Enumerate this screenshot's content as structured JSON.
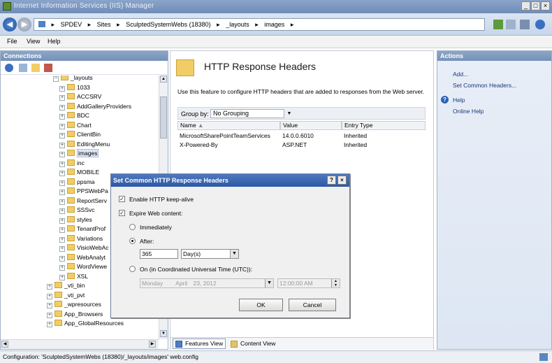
{
  "window": {
    "title": "Internet Information Services (IIS) Manager",
    "min": "_",
    "max": "□",
    "close": "×"
  },
  "address": {
    "crumbs": [
      "SPDEV",
      "Sites",
      "SculptedSystemWebs (18380)",
      "_layouts",
      "images"
    ]
  },
  "menu": {
    "file": "File",
    "view": "View",
    "help": "Help"
  },
  "connections": {
    "title": "Connections",
    "tree": [
      {
        "label": "_layouts",
        "pm": "−"
      },
      {
        "label": "1033",
        "pm": "+"
      },
      {
        "label": "ACCSRV",
        "pm": "+"
      },
      {
        "label": "AddGalleryProviders",
        "pm": "+"
      },
      {
        "label": "BDC",
        "pm": "+"
      },
      {
        "label": "Chart",
        "pm": "+"
      },
      {
        "label": "ClientBin",
        "pm": "+"
      },
      {
        "label": "EditingMenu",
        "pm": "+"
      },
      {
        "label": "images",
        "pm": "+"
      },
      {
        "label": "inc",
        "pm": "+"
      },
      {
        "label": "MOBILE",
        "pm": "+"
      },
      {
        "label": "ppsma",
        "pm": "+"
      },
      {
        "label": "PPSWebPa",
        "pm": "+"
      },
      {
        "label": "ReportServ",
        "pm": "+"
      },
      {
        "label": "SSSvc",
        "pm": "+"
      },
      {
        "label": "styles",
        "pm": "+"
      },
      {
        "label": "TenantProf",
        "pm": "+"
      },
      {
        "label": "Variations",
        "pm": "+"
      },
      {
        "label": "VisioWebAc",
        "pm": "+"
      },
      {
        "label": "WebAnalyt",
        "pm": "+"
      },
      {
        "label": "WordViewe",
        "pm": "+"
      },
      {
        "label": "XSL",
        "pm": "+"
      },
      {
        "label": "_vti_bin",
        "pm": "+"
      },
      {
        "label": "_vti_pvt",
        "pm": "+"
      },
      {
        "label": "_wpresources",
        "pm": "+"
      },
      {
        "label": "App_Browsers",
        "pm": "+"
      },
      {
        "label": "App_GlobalResources",
        "pm": "+"
      }
    ]
  },
  "feature": {
    "title": "HTTP Response Headers",
    "description": "Use this feature to configure HTTP headers that are added to responses from the Web server.",
    "group_by_label": "Group by:",
    "group_by_value": "No Grouping",
    "columns": [
      "Name",
      "Value",
      "Entry Type"
    ],
    "rows": [
      [
        "MicrosoftSharePointTeamServices",
        "14.0.0.6010",
        "Inherited"
      ],
      [
        "X-Powered-By",
        "ASP.NET",
        "Inherited"
      ]
    ]
  },
  "views": {
    "features": "Features View",
    "content": "Content View"
  },
  "actions": {
    "title": "Actions",
    "add": "Add...",
    "set_common": "Set Common Headers...",
    "help": "Help",
    "online_help": "Online Help"
  },
  "status": {
    "text": "Configuration: 'SculptedSystemWebs (18380)/_layouts/images' web.config"
  },
  "dialog": {
    "title": "Set Common HTTP Response Headers",
    "help_btn": "?",
    "close_btn": "×",
    "keepalive_label": "Enable HTTP keep-alive",
    "keepalive_checked": true,
    "expire_label": "Expire Web content:",
    "expire_checked": true,
    "immediately_label": "Immediately",
    "after_label": "After:",
    "after_value": "365",
    "after_unit": "Day(s)",
    "on_label": "On (in Coordinated Universal Time (UTC)):",
    "date_day": "Monday",
    "date_month": "April",
    "date_rest": "23, 2012",
    "time_value": "12:00:00 AM",
    "ok": "OK",
    "cancel": "Cancel"
  }
}
